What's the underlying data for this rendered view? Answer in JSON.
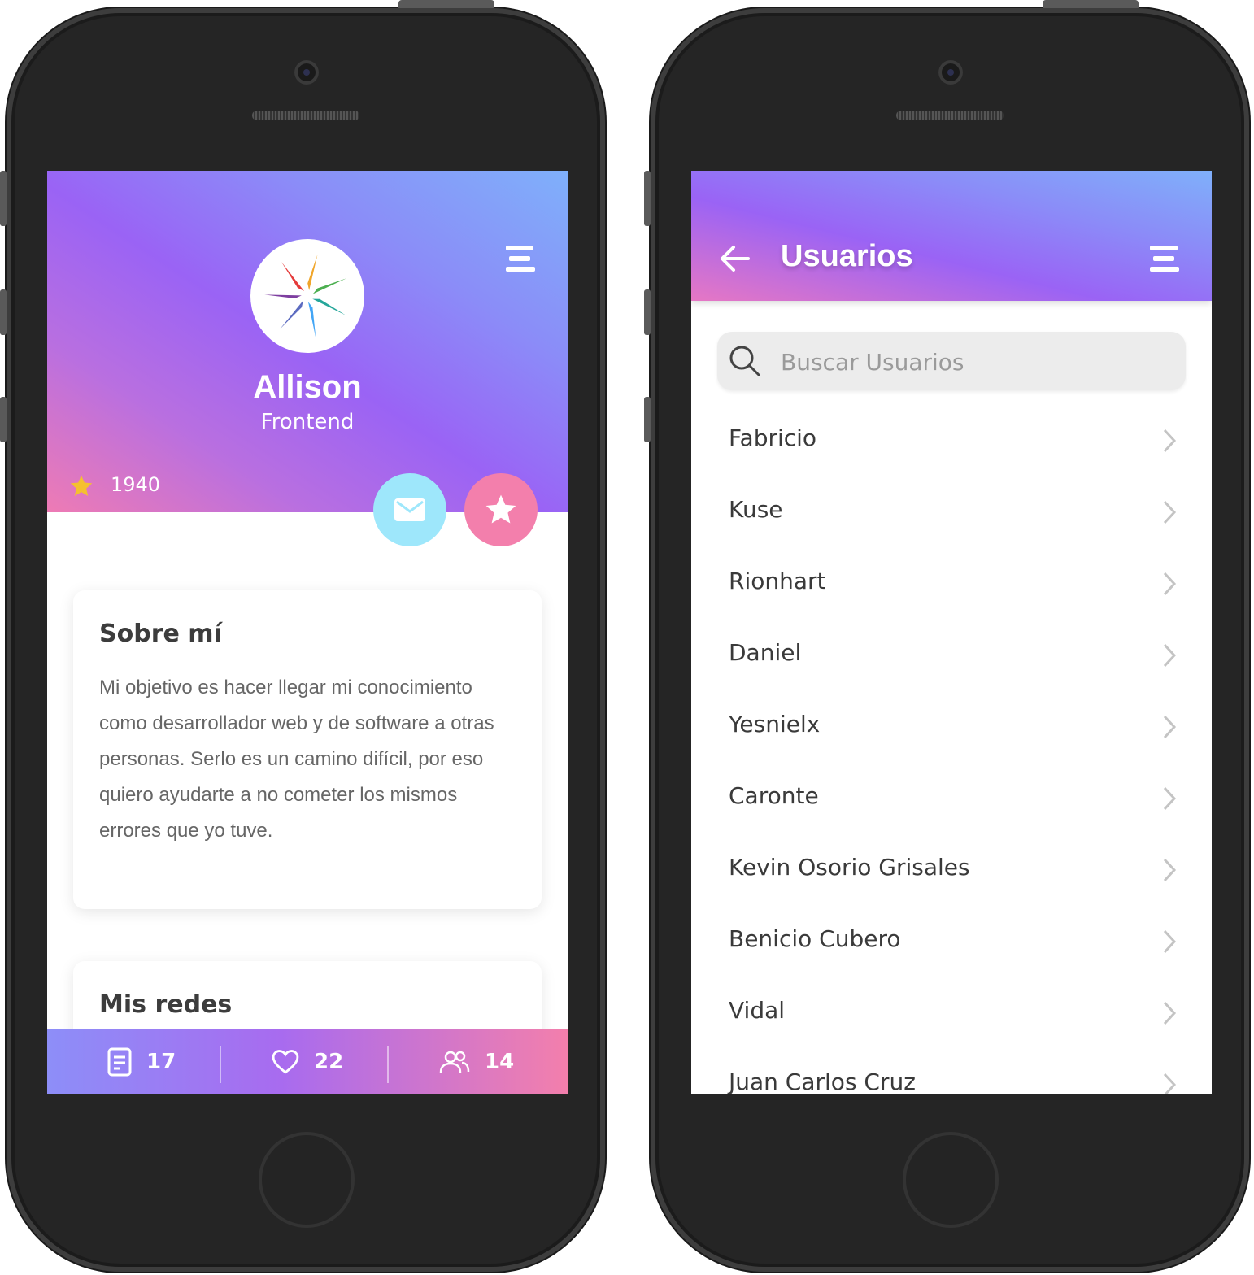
{
  "profile": {
    "name": "Allison",
    "role": "Frontend",
    "rating": "1940",
    "about": {
      "title": "Sobre mí",
      "text": "Mi objetivo es hacer llegar mi conocimiento como desarrollador web y de software a otras personas. Serlo es un camino difícil, por eso quiero ayudarte a no cometer los mismos errores que yo tuve."
    },
    "networks": {
      "title": "Mis redes"
    },
    "stats": {
      "posts": "17",
      "likes": "22",
      "friends": "14"
    }
  },
  "users_screen": {
    "title": "Usuarios",
    "search_placeholder": "Buscar Usuarios",
    "users": [
      "Fabricio",
      "Kuse",
      "Rionhart",
      "Daniel",
      "Yesnielx",
      "Caronte",
      "Kevin Osorio Grisales",
      "Benicio Cubero",
      "Vidal",
      "Juan Carlos Cruz"
    ]
  },
  "icons": {
    "menu": "hamburger-menu-icon",
    "rating": "star-icon",
    "mail": "mail-icon",
    "favorite": "star-icon",
    "posts": "document-icon",
    "likes": "heart-icon",
    "friends": "users-icon",
    "back": "arrow-left-icon",
    "search": "search-icon",
    "row": "chevron-right-icon"
  },
  "colors": {
    "rating_star": "#f5c030",
    "mail_fab": "#9ee7fb",
    "favorite_fab": "#f37fac",
    "gradient_purple": "#9a63f5",
    "gradient_blue": "#7fb0fa",
    "gradient_pink": "#ee7bb4"
  }
}
